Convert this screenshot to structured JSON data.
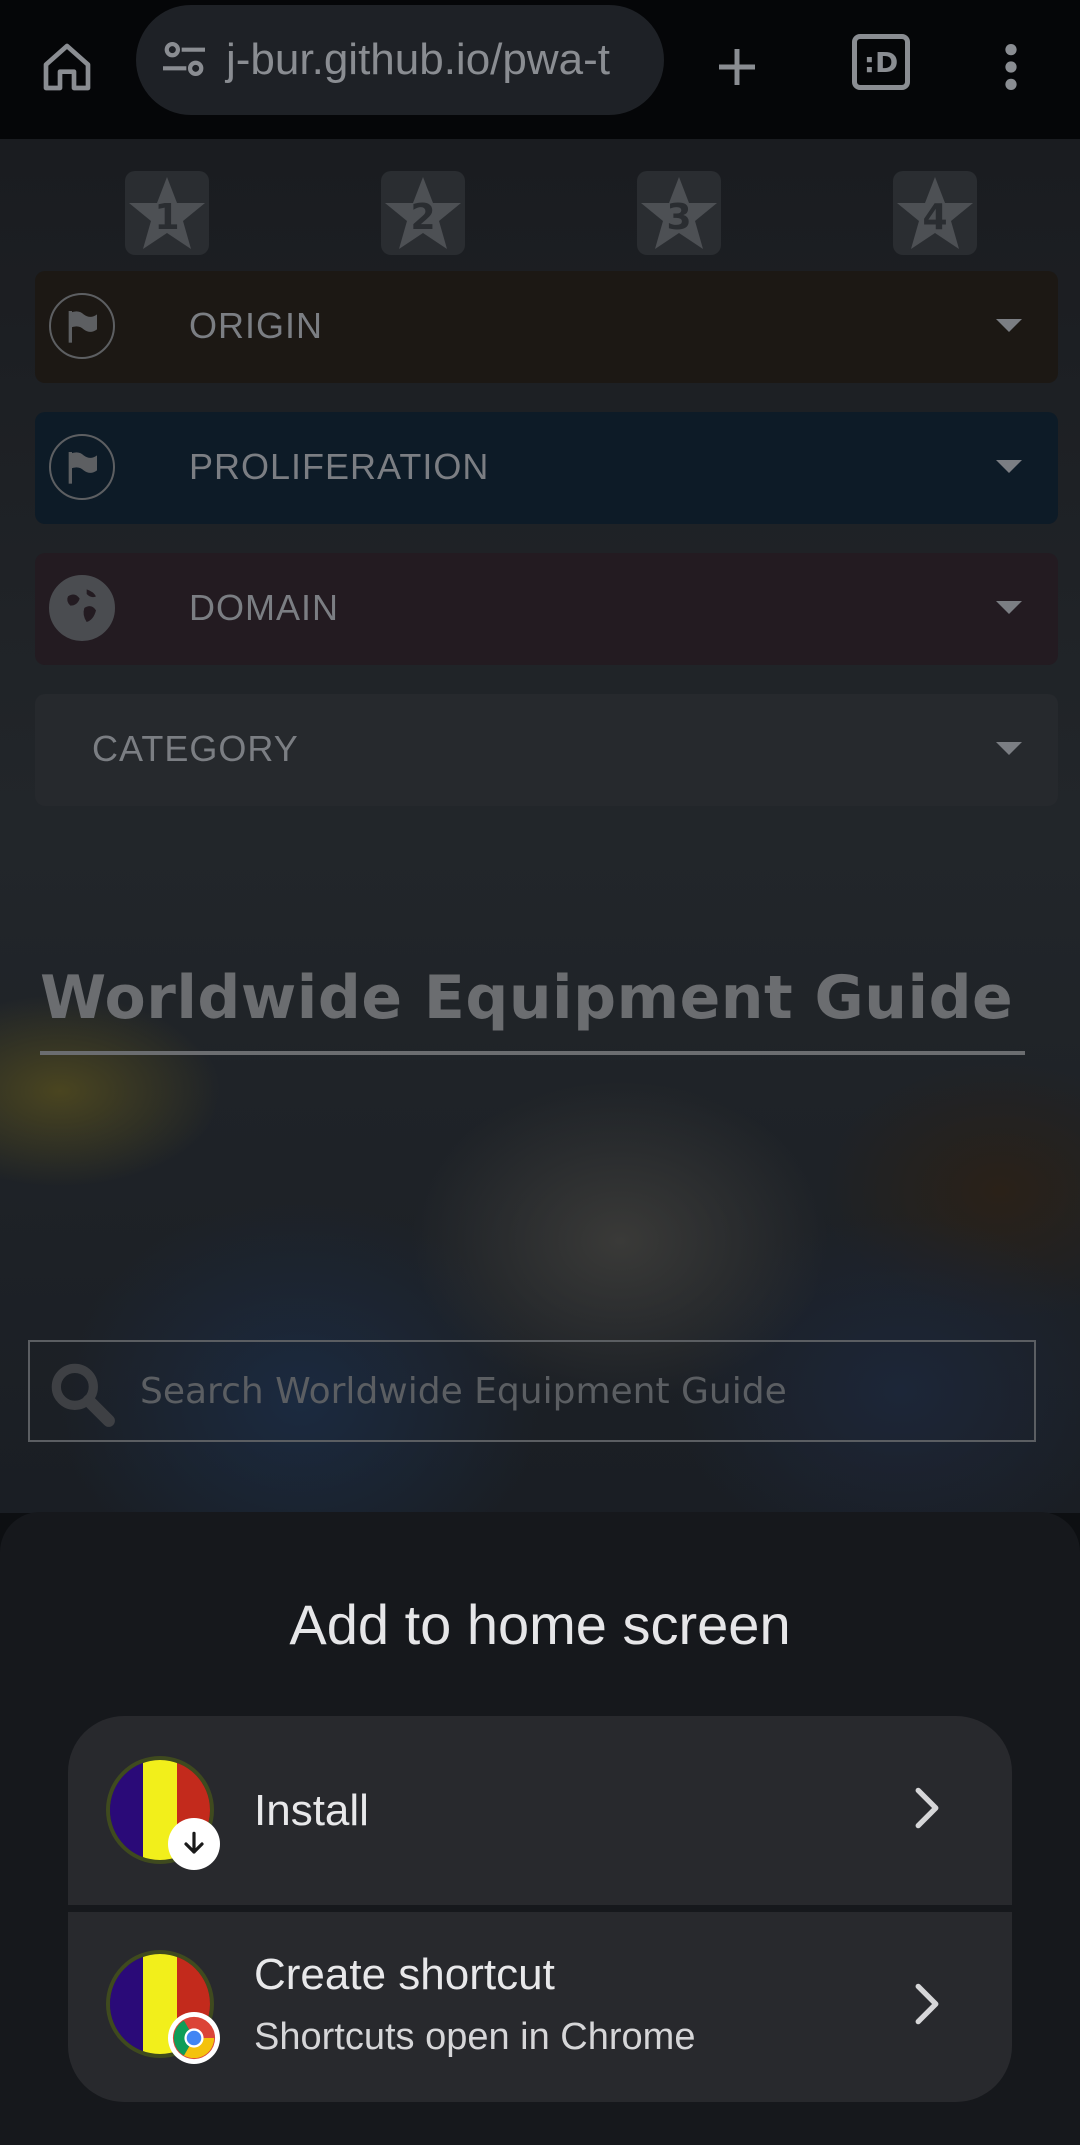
{
  "browser": {
    "url": "j-bur.github.io/pwa-t",
    "tab_count": ":D",
    "icons": [
      "home-icon",
      "site-settings-icon",
      "new-tab-icon",
      "tab-switcher-icon",
      "overflow-menu-icon"
    ]
  },
  "page": {
    "star_tabs": [
      "1",
      "2",
      "3",
      "4"
    ],
    "dropdowns": [
      {
        "label": "ORIGIN",
        "color": "#1c1814",
        "icon": "flag-icon"
      },
      {
        "label": "PROLIFERATION",
        "color": "#0d1b27",
        "icon": "flag-icon"
      },
      {
        "label": "DOMAIN",
        "color": "#231b21",
        "icon": "globe-icon"
      },
      {
        "label": "CATEGORY",
        "color": "#26292d",
        "icon": ""
      }
    ],
    "title": "Worldwide Equipment Guide",
    "search_placeholder": "Search Worldwide Equipment Guide"
  },
  "sheet": {
    "title": "Add to home screen",
    "install_label": "Install",
    "shortcut_label": "Create shortcut",
    "shortcut_sub": "Shortcuts open in Chrome",
    "app_icon_colors": [
      "#2a0a78",
      "#f2ef1b",
      "#c32a1c"
    ]
  }
}
